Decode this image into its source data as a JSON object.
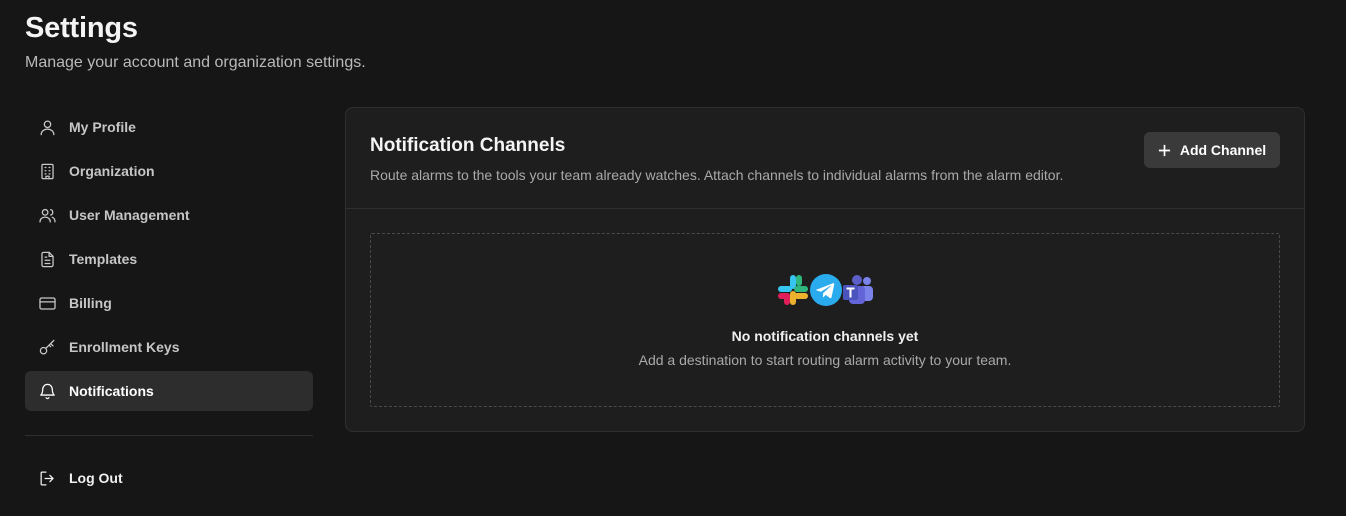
{
  "header": {
    "title": "Settings",
    "subtitle": "Manage your account and organization settings."
  },
  "sidebar": {
    "items": [
      {
        "label": "My Profile",
        "icon": "user-icon",
        "active": false
      },
      {
        "label": "Organization",
        "icon": "building-icon",
        "active": false
      },
      {
        "label": "User Management",
        "icon": "users-icon",
        "active": false
      },
      {
        "label": "Templates",
        "icon": "file-text-icon",
        "active": false
      },
      {
        "label": "Billing",
        "icon": "credit-card-icon",
        "active": false
      },
      {
        "label": "Enrollment Keys",
        "icon": "key-icon",
        "active": false
      },
      {
        "label": "Notifications",
        "icon": "bell-icon",
        "active": true
      }
    ],
    "logout_label": "Log Out"
  },
  "card": {
    "title": "Notification Channels",
    "description": "Route alarms to the tools your team already watches. Attach channels to individual alarms from the alarm editor.",
    "add_button_label": "Add Channel",
    "empty_state": {
      "icons": [
        "slack-icon",
        "telegram-icon",
        "teams-icon"
      ],
      "title": "No notification channels yet",
      "description": "Add a destination to start routing alarm activity to your team."
    }
  },
  "colors": {
    "background": "#161616",
    "card": "#1e1e1e",
    "active_nav": "#2d2d2d",
    "button": "#3a3a3a",
    "telegram": "#2AABEE",
    "teams": "#5B5FC7"
  }
}
